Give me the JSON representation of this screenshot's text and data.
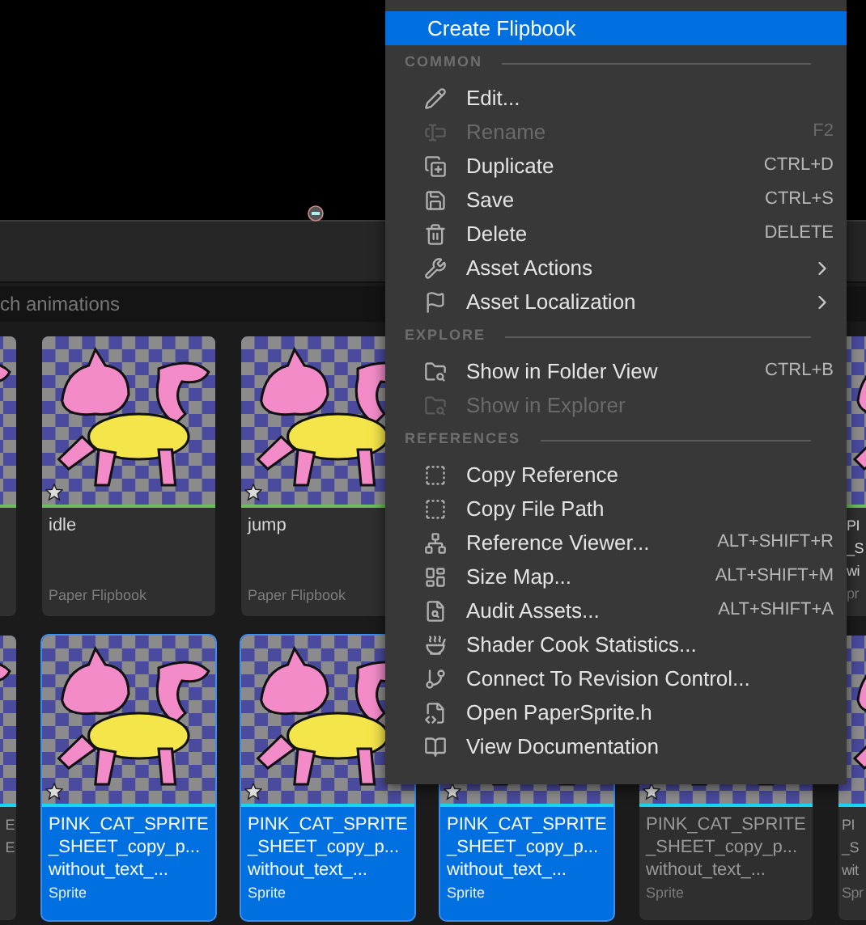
{
  "search": {
    "placeholder": "ch animations"
  },
  "asset_rows": [
    {
      "kind": "flipbook",
      "tiles": [
        {
          "kind": "edge_left"
        },
        {
          "kind": "full",
          "selected": false,
          "name_lines": [
            "idle"
          ],
          "type": "Paper Flipbook"
        },
        {
          "kind": "full",
          "selected": false,
          "name_lines": [
            "jump"
          ],
          "type": "Paper Flipbook"
        },
        {
          "kind": "edge_right",
          "name_lines": [
            "PI",
            "_S",
            "wi"
          ],
          "type": "pr"
        }
      ]
    },
    {
      "kind": "sprite",
      "tiles": [
        {
          "kind": "edge_left",
          "name_lines": [
            "E",
            "E"
          ]
        },
        {
          "kind": "full",
          "selected": true,
          "name_lines": [
            "PINK_CAT_SPRITE",
            "_SHEET_copy_p...",
            "without_text_..."
          ],
          "type": "Sprite"
        },
        {
          "kind": "full",
          "selected": true,
          "name_lines": [
            "PINK_CAT_SPRITE",
            "_SHEET_copy_p...",
            "without_text_..."
          ],
          "type": "Sprite"
        },
        {
          "kind": "full",
          "selected": true,
          "name_lines": [
            "PINK_CAT_SPRITE",
            "_SHEET_copy_p...",
            "without_text_..."
          ],
          "type": "Sprite"
        },
        {
          "kind": "full",
          "selected": false,
          "name_lines": [
            "PINK_CAT_SPRITE",
            "_SHEET_copy_p...",
            "without_text_..."
          ],
          "type": "Sprite"
        },
        {
          "kind": "edge_right",
          "name_lines": [
            "PI",
            "_S",
            "wit"
          ],
          "type": "Spr"
        }
      ]
    }
  ],
  "context_menu": {
    "top_item": {
      "label": "Create Flipbook",
      "selected": true
    },
    "sections": [
      {
        "header": "COMMON",
        "items": [
          {
            "label": "Edit...",
            "disabled": false,
            "has_submenu": false
          },
          {
            "label": "Rename",
            "shortcut": "F2",
            "disabled": true,
            "has_submenu": false
          },
          {
            "label": "Duplicate",
            "shortcut": "CTRL+D",
            "disabled": false,
            "has_submenu": false
          },
          {
            "label": "Save",
            "shortcut": "CTRL+S",
            "disabled": false,
            "has_submenu": false
          },
          {
            "label": "Delete",
            "shortcut": "DELETE",
            "disabled": false,
            "has_submenu": false
          },
          {
            "label": "Asset Actions",
            "disabled": false,
            "has_submenu": true
          },
          {
            "label": "Asset Localization",
            "disabled": false,
            "has_submenu": true
          }
        ]
      },
      {
        "header": "EXPLORE",
        "items": [
          {
            "label": "Show in Folder View",
            "shortcut": "CTRL+B",
            "disabled": false,
            "has_submenu": false
          },
          {
            "label": "Show in Explorer",
            "disabled": true,
            "has_submenu": false
          }
        ]
      },
      {
        "header": "REFERENCES",
        "items": [
          {
            "label": "Copy Reference",
            "disabled": false,
            "has_submenu": false
          },
          {
            "label": "Copy File Path",
            "disabled": false,
            "has_submenu": false
          },
          {
            "label": "Reference Viewer...",
            "shortcut": "ALT+SHIFT+R",
            "disabled": false,
            "has_submenu": false
          },
          {
            "label": "Size Map...",
            "shortcut": "ALT+SHIFT+M",
            "disabled": false,
            "has_submenu": false
          },
          {
            "label": "Audit Assets...",
            "shortcut": "ALT+SHIFT+A",
            "disabled": false,
            "has_submenu": false
          },
          {
            "label": "Shader Cook Statistics...",
            "disabled": false,
            "has_submenu": false
          },
          {
            "label": "Connect To Revision Control...",
            "disabled": false,
            "has_submenu": false
          },
          {
            "label": "Open PaperSprite.h",
            "disabled": false,
            "has_submenu": false
          },
          {
            "label": "View Documentation",
            "disabled": false,
            "has_submenu": false
          }
        ]
      }
    ]
  }
}
